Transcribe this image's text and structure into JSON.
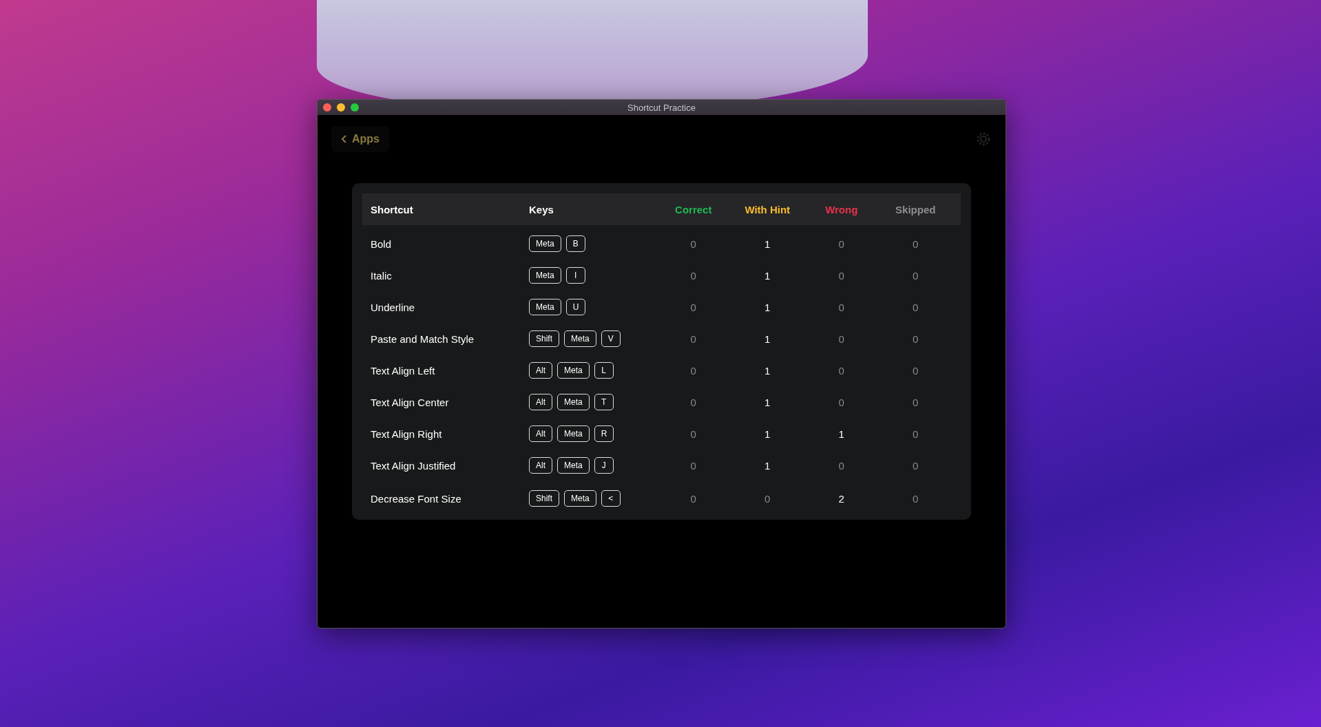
{
  "window": {
    "title": "Shortcut Practice"
  },
  "toolbar": {
    "back_label": "Apps"
  },
  "table": {
    "columns": [
      {
        "label": "Shortcut",
        "kind": "name"
      },
      {
        "label": "Keys",
        "kind": "keys"
      },
      {
        "label": "Correct",
        "kind": "count",
        "color": "#1db954"
      },
      {
        "label": "With Hint",
        "kind": "count",
        "color": "#fbbc2c"
      },
      {
        "label": "Wrong",
        "kind": "count",
        "color": "#e8334a"
      },
      {
        "label": "Skipped",
        "kind": "count",
        "color": "#8e8e93"
      }
    ],
    "rows": [
      {
        "shortcut": "Bold",
        "keys": [
          "Meta",
          "B"
        ],
        "counts": [
          {
            "value": "0",
            "emphasized": false
          },
          {
            "value": "1",
            "emphasized": true
          },
          {
            "value": "0",
            "emphasized": false
          },
          {
            "value": "0",
            "emphasized": false
          }
        ]
      },
      {
        "shortcut": "Italic",
        "keys": [
          "Meta",
          "I"
        ],
        "counts": [
          {
            "value": "0",
            "emphasized": false
          },
          {
            "value": "1",
            "emphasized": true
          },
          {
            "value": "0",
            "emphasized": false
          },
          {
            "value": "0",
            "emphasized": false
          }
        ]
      },
      {
        "shortcut": "Underline",
        "keys": [
          "Meta",
          "U"
        ],
        "counts": [
          {
            "value": "0",
            "emphasized": false
          },
          {
            "value": "1",
            "emphasized": true
          },
          {
            "value": "0",
            "emphasized": false
          },
          {
            "value": "0",
            "emphasized": false
          }
        ]
      },
      {
        "shortcut": "Paste and Match Style",
        "keys": [
          "Shift",
          "Meta",
          "V"
        ],
        "counts": [
          {
            "value": "0",
            "emphasized": false
          },
          {
            "value": "1",
            "emphasized": true
          },
          {
            "value": "0",
            "emphasized": false
          },
          {
            "value": "0",
            "emphasized": false
          }
        ]
      },
      {
        "shortcut": "Text Align Left",
        "keys": [
          "Alt",
          "Meta",
          "L"
        ],
        "counts": [
          {
            "value": "0",
            "emphasized": false
          },
          {
            "value": "1",
            "emphasized": true
          },
          {
            "value": "0",
            "emphasized": false
          },
          {
            "value": "0",
            "emphasized": false
          }
        ]
      },
      {
        "shortcut": "Text Align Center",
        "keys": [
          "Alt",
          "Meta",
          "T"
        ],
        "counts": [
          {
            "value": "0",
            "emphasized": false
          },
          {
            "value": "1",
            "emphasized": true
          },
          {
            "value": "0",
            "emphasized": false
          },
          {
            "value": "0",
            "emphasized": false
          }
        ]
      },
      {
        "shortcut": "Text Align Right",
        "keys": [
          "Alt",
          "Meta",
          "R"
        ],
        "counts": [
          {
            "value": "0",
            "emphasized": false
          },
          {
            "value": "1",
            "emphasized": true
          },
          {
            "value": "1",
            "emphasized": true
          },
          {
            "value": "0",
            "emphasized": false
          }
        ]
      },
      {
        "shortcut": "Text Align Justified",
        "keys": [
          "Alt",
          "Meta",
          "J"
        ],
        "counts": [
          {
            "value": "0",
            "emphasized": false
          },
          {
            "value": "1",
            "emphasized": true
          },
          {
            "value": "0",
            "emphasized": false
          },
          {
            "value": "0",
            "emphasized": false
          }
        ]
      },
      {
        "shortcut": "Decrease Font Size",
        "keys": [
          "Shift",
          "Meta",
          "<"
        ],
        "counts": [
          {
            "value": "0",
            "emphasized": false
          },
          {
            "value": "0",
            "emphasized": false
          },
          {
            "value": "2",
            "emphasized": true
          },
          {
            "value": "0",
            "emphasized": false
          }
        ]
      }
    ]
  }
}
